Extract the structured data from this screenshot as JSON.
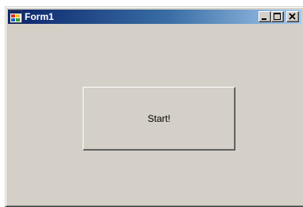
{
  "window": {
    "title": "Form1",
    "icon": "form-app-icon",
    "controls": [
      "minimize-icon",
      "maximize-icon",
      "close-icon"
    ]
  },
  "form": {
    "start_button_label": "Start!"
  },
  "colors": {
    "title_gradient_start": "#0a246a",
    "title_gradient_end": "#a6caf0",
    "face": "#d4d0c8"
  }
}
